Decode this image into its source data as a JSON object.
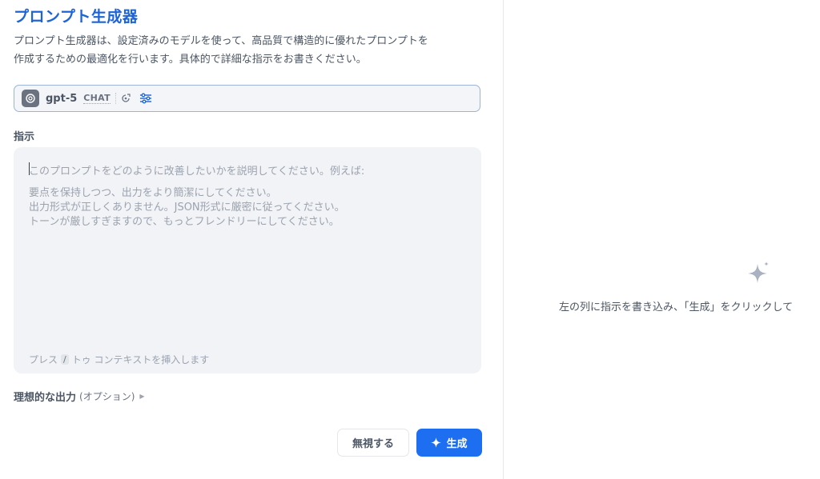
{
  "header": {
    "title": "プロンプト生成器",
    "description_line1": "プロンプト生成器は、設定済みのモデルを使って、高品質で構造的に優れたプロンプトを",
    "description_line2": "作成するための最適化を行います。具体的で詳細な指示をお書きください。"
  },
  "model": {
    "name": "gpt-5",
    "mode": "CHAT",
    "icons": [
      "openai-logo-icon",
      "model-settings-icon",
      "sliders-icon"
    ]
  },
  "instructions": {
    "label": "指示",
    "placeholder_first": "このプロンプトをどのように改善したいかを説明してください。例えば:",
    "examples": [
      "要点を保持しつつ、出力をより簡潔にしてください。",
      "出力形式が正しくありません。JSON形式に厳密に従ってください。",
      "トーンが厳しすぎますので、もっとフレンドリーにしてください。"
    ],
    "hint_prefix": "プレス",
    "hint_key": "/",
    "hint_suffix": "トゥ コンテキストを挿入します"
  },
  "ideal_output": {
    "label": "理想的な出力",
    "optional": "(オプション)"
  },
  "actions": {
    "ignore_label": "無視する",
    "generate_label": "生成"
  },
  "right_panel": {
    "empty_text": "左の列に指示を書き込み、「生成」をクリックして"
  },
  "colors": {
    "title": "#1d64d8",
    "primary_button": "#1d6ef0",
    "input_bg": "#f1f3f6"
  }
}
